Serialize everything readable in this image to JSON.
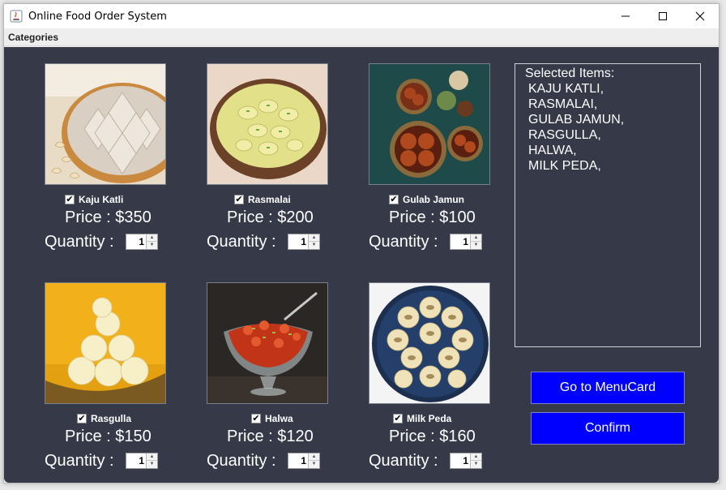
{
  "window": {
    "title": "Online Food Order System",
    "minimize_icon": "minimize-icon",
    "maximize_icon": "maximize-icon",
    "close_icon": "close-icon"
  },
  "menubar": {
    "categories_label": "Categories"
  },
  "colors": {
    "content_bg": "#363a48",
    "button_bg": "#0000ff",
    "text": "#ffffff"
  },
  "items": [
    {
      "name": "Kaju Katli",
      "checked": true,
      "price_text": "Price : $350",
      "qty_label": "Quantity :",
      "quantity": "1",
      "image_icon": "kaju-katli-image"
    },
    {
      "name": "Rasmalai",
      "checked": true,
      "price_text": "Price : $200",
      "qty_label": "Quantity :",
      "quantity": "1",
      "image_icon": "rasmalai-image"
    },
    {
      "name": "Gulab Jamun",
      "checked": true,
      "price_text": "Price : $100",
      "qty_label": "Quantity :",
      "quantity": "1",
      "image_icon": "gulab-jamun-image"
    },
    {
      "name": "Rasgulla",
      "checked": true,
      "price_text": "Price : $150",
      "qty_label": "Quantity :",
      "quantity": "1",
      "image_icon": "rasgulla-image"
    },
    {
      "name": "Halwa",
      "checked": true,
      "price_text": "Price : $120",
      "qty_label": "Quantity :",
      "quantity": "1",
      "image_icon": "halwa-image"
    },
    {
      "name": "Milk Peda",
      "checked": true,
      "price_text": "Price : $160",
      "qty_label": "Quantity :",
      "quantity": "1",
      "image_icon": "milk-peda-image"
    }
  ],
  "selected": {
    "title": "Selected Items:",
    "lines": [
      "KAJU KATLI,",
      "RASMALAI,",
      "GULAB JAMUN,",
      "RASGULLA,",
      "HALWA,",
      "MILK PEDA,"
    ]
  },
  "buttons": {
    "menu_card": "Go to MenuCard",
    "confirm": "Confirm"
  }
}
